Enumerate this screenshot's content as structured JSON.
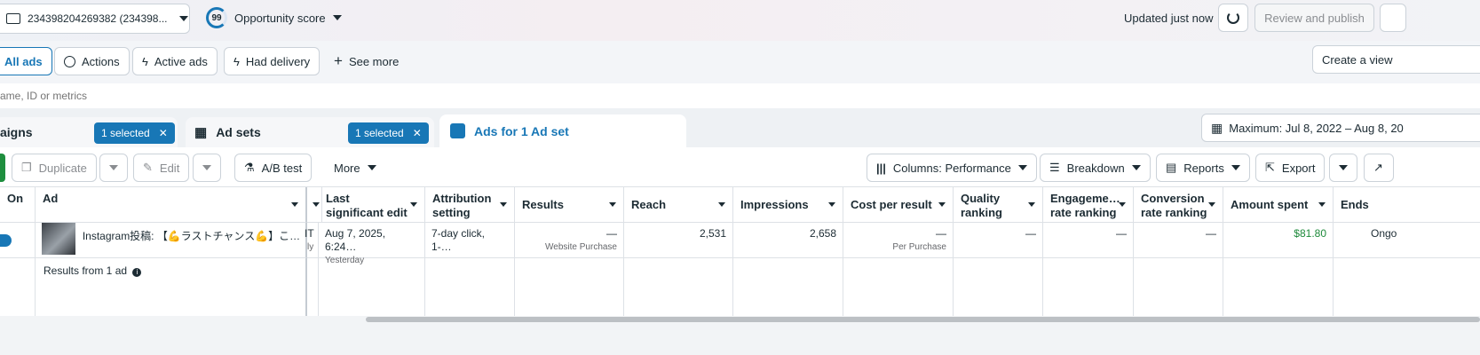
{
  "topbar": {
    "account_label": "234398204269382 (234398...",
    "score_value": "99",
    "score_label": "Opportunity score",
    "updated": "Updated just now",
    "review_publish": "Review and publish"
  },
  "filters": {
    "all_ads": "All ads",
    "actions": "Actions",
    "active_ads": "Active ads",
    "had_delivery": "Had delivery",
    "see_more": "See more",
    "create_view": "Create a view"
  },
  "search": {
    "placeholder": "ame, ID or metrics"
  },
  "tabs": {
    "campaigns": "aigns",
    "campaigns_selected": "1 selected",
    "adsets": "Ad sets",
    "adsets_selected": "1 selected",
    "ads": "Ads for 1 Ad set",
    "date_range": "Maximum: Jul 8, 2022 – Aug 8, 20"
  },
  "toolbar": {
    "duplicate": "Duplicate",
    "edit": "Edit",
    "ab_test": "A/B test",
    "more": "More",
    "columns": "Columns: Performance",
    "breakdown": "Breakdown",
    "reports": "Reports",
    "export": "Export"
  },
  "table": {
    "headers": {
      "on": "On",
      "ad": "Ad",
      "last_edit": "Last significant edit",
      "attribution": "Attribution setting",
      "results": "Results",
      "reach": "Reach",
      "impressions": "Impressions",
      "cost_per_result": "Cost per result",
      "quality": "Quality ranking",
      "engagement": "Engageme… rate ranking",
      "conversion": "Conversion rate ranking",
      "amount_spent": "Amount spent",
      "ends": "Ends"
    },
    "row": {
      "ad_name": "Instagram投稿: 【💪ラストチャンス💪】こ…",
      "partial_left": "IT",
      "partial_left_sub": "ly",
      "last_edit": "Aug 7, 2025, 6:24…",
      "last_edit_sub": "Yesterday",
      "attribution": "7-day click, 1-…",
      "results": "—",
      "results_sub": "Website Purchase",
      "reach": "2,531",
      "impressions": "2,658",
      "cost_per_result": "—",
      "cost_per_result_sub": "Per Purchase",
      "quality": "—",
      "engagement": "—",
      "conversion": "—",
      "amount_spent": "$81.80",
      "ends": "Ongo"
    },
    "summary": "Results from 1 ad"
  },
  "colors": {
    "accent": "#1877b6",
    "green": "#1e8e3e",
    "spent": "#1e8a3b"
  }
}
